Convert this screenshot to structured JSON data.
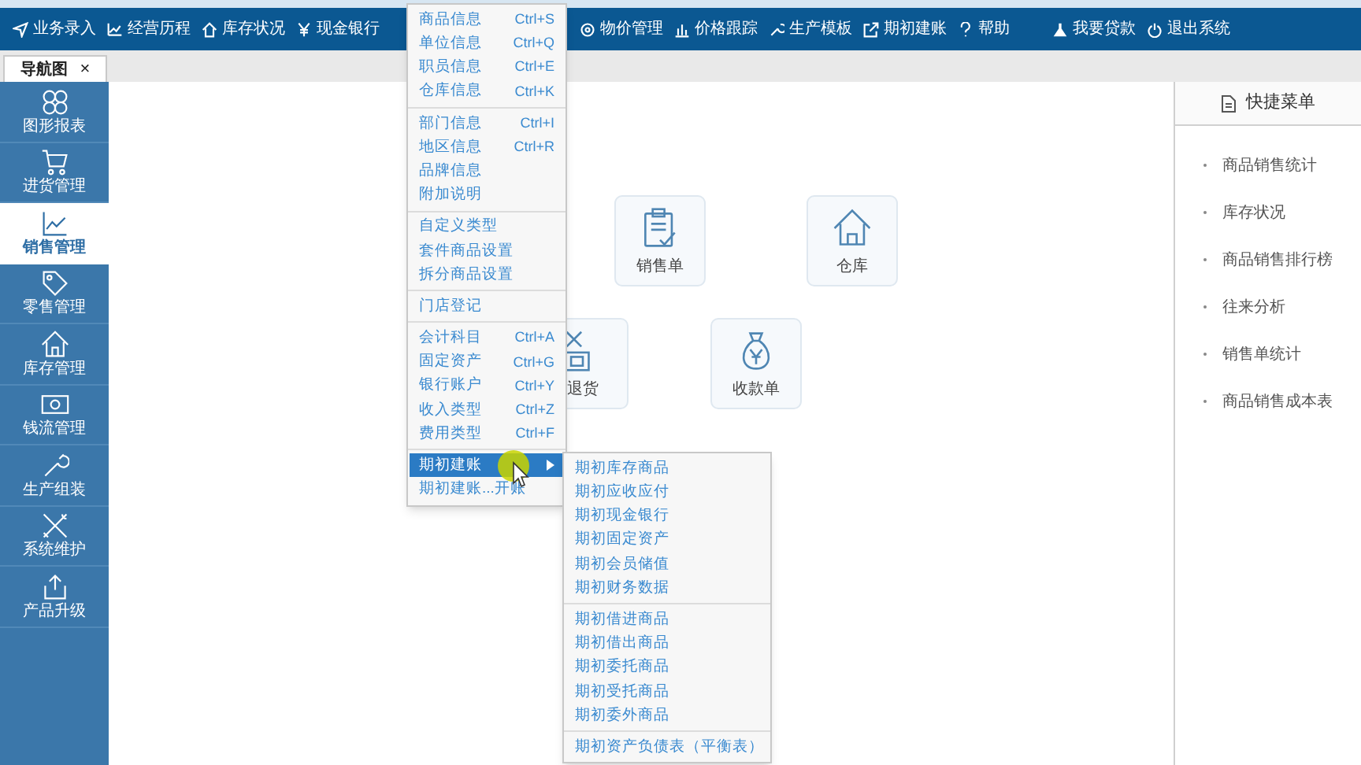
{
  "top_nav": [
    {
      "label": "业务录入"
    },
    {
      "label": "经营历程"
    },
    {
      "label": "库存状况"
    },
    {
      "label": "现金银行"
    },
    {
      "label": "物价管理"
    },
    {
      "label": "价格跟踪"
    },
    {
      "label": "生产模板"
    },
    {
      "label": "期初建账"
    },
    {
      "label": "帮助"
    },
    {
      "label": "我要贷款"
    },
    {
      "label": "退出系统"
    }
  ],
  "tabs": [
    {
      "label": "导航图",
      "close": "×",
      "selected": true
    }
  ],
  "sidebar": {
    "items": [
      {
        "label": "图形报表",
        "selected": false
      },
      {
        "label": "进货管理",
        "selected": false
      },
      {
        "label": "销售管理",
        "selected": true
      },
      {
        "label": "零售管理",
        "selected": false
      },
      {
        "label": "库存管理",
        "selected": false
      },
      {
        "label": "钱流管理",
        "selected": false
      },
      {
        "label": "生产组装",
        "selected": false
      },
      {
        "label": "系统维护",
        "selected": false
      },
      {
        "label": "产品升级",
        "selected": false
      }
    ]
  },
  "tiles": [
    {
      "label": "销售单"
    },
    {
      "label": "仓库"
    },
    {
      "label": "退货"
    },
    {
      "label": "收款单"
    }
  ],
  "quick_menu": {
    "title": "快捷菜单",
    "items": [
      "商品销售统计",
      "库存状况",
      "商品销售排行榜",
      "往来分析",
      "销售单统计",
      "商品销售成本表"
    ]
  },
  "menu": {
    "groups": [
      [
        {
          "label": "商品信息",
          "shortcut": "Ctrl+S",
          "selected": false,
          "submenu": false
        },
        {
          "label": "单位信息",
          "shortcut": "Ctrl+Q",
          "selected": false,
          "submenu": false
        },
        {
          "label": "职员信息",
          "shortcut": "Ctrl+E",
          "selected": false,
          "submenu": false
        },
        {
          "label": "仓库信息",
          "shortcut": "Ctrl+K",
          "selected": false,
          "submenu": false
        }
      ],
      [
        {
          "label": "部门信息",
          "shortcut": "Ctrl+I",
          "selected": false,
          "submenu": false
        },
        {
          "label": "地区信息",
          "shortcut": "Ctrl+R",
          "selected": false,
          "submenu": false
        },
        {
          "label": "品牌信息",
          "selected": false,
          "submenu": false
        },
        {
          "label": "附加说明",
          "selected": false,
          "submenu": false
        }
      ],
      [
        {
          "label": "自定义类型",
          "selected": false,
          "submenu": false
        },
        {
          "label": "套件商品设置",
          "selected": false,
          "submenu": false
        },
        {
          "label": "拆分商品设置",
          "selected": false,
          "submenu": false
        }
      ],
      [
        {
          "label": "门店登记",
          "selected": false,
          "submenu": false
        }
      ],
      [
        {
          "label": "会计科目",
          "shortcut": "Ctrl+A",
          "selected": false,
          "submenu": false
        },
        {
          "label": "固定资产",
          "shortcut": "Ctrl+G",
          "selected": false,
          "submenu": false
        },
        {
          "label": "银行账户",
          "shortcut": "Ctrl+Y",
          "selected": false,
          "submenu": false
        },
        {
          "label": "收入类型",
          "shortcut": "Ctrl+Z",
          "selected": false,
          "submenu": false
        },
        {
          "label": "费用类型",
          "shortcut": "Ctrl+F",
          "selected": false,
          "submenu": false
        }
      ],
      [
        {
          "label": "期初建账",
          "selected": true,
          "submenu": true
        },
        {
          "label": "期初建账...开账",
          "selected": false,
          "submenu": false
        }
      ]
    ]
  },
  "submenu": {
    "groups": [
      [
        "期初库存商品",
        "期初应收应付",
        "期初现金银行",
        "期初固定资产",
        "期初会员储值",
        "期初财务数据"
      ],
      [
        "期初借进商品",
        "期初借出商品",
        "期初委托商品",
        "期初受托商品",
        "期初委外商品"
      ],
      [
        "期初资产负债表（平衡表）"
      ]
    ]
  }
}
